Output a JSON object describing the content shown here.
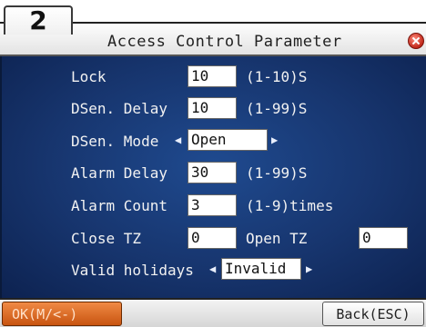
{
  "step_number": "2",
  "window": {
    "title": "Access Control Parameter",
    "close_icon": "close-icon"
  },
  "colors": {
    "panel_bg": "#17356e",
    "ok_button": "#e0722c",
    "close_button": "#d23a2a"
  },
  "fields": {
    "lock": {
      "label": "Lock",
      "value": "10",
      "range": "(1-10)S"
    },
    "dsen_delay": {
      "label": "DSen. Delay",
      "value": "10",
      "range": "(1-99)S"
    },
    "dsen_mode": {
      "label": "DSen. Mode",
      "value": "Open"
    },
    "alarm_delay": {
      "label": "Alarm Delay",
      "value": "30",
      "range": "(1-99)S"
    },
    "alarm_count": {
      "label": "Alarm Count",
      "value": "3",
      "range": "(1-9)times"
    },
    "close_tz": {
      "label": "Close TZ",
      "value": "0"
    },
    "open_tz": {
      "label": "Open TZ",
      "value": "0"
    },
    "valid_holidays": {
      "label": "Valid holidays",
      "value": "Invalid"
    }
  },
  "buttons": {
    "ok": "OK(M/<-)",
    "back": "Back(ESC)"
  }
}
